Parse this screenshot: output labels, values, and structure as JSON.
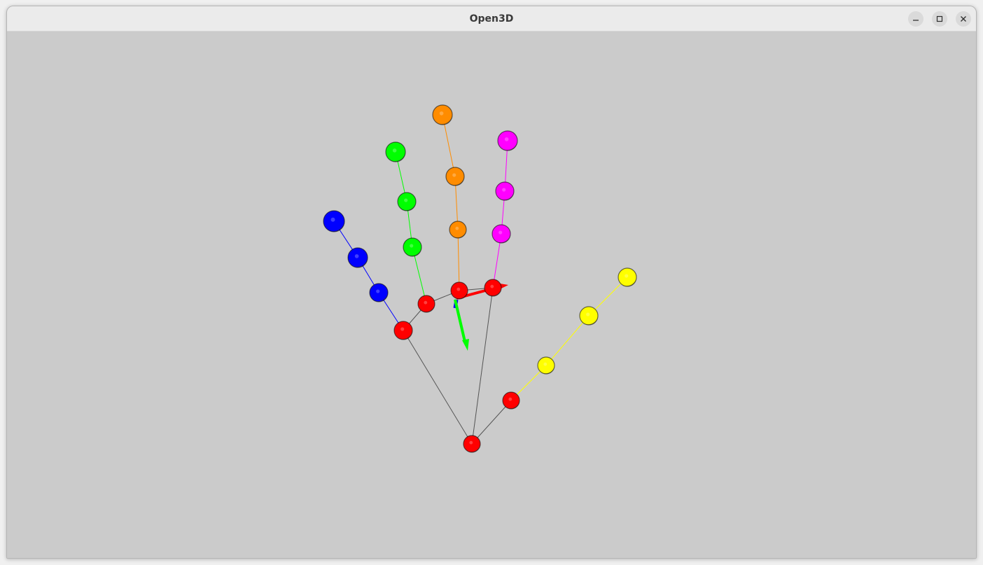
{
  "window": {
    "title": "Open3D",
    "controls": {
      "minimize": "minimize-icon",
      "maximize": "maximize-icon",
      "close": "close-icon"
    }
  },
  "scene": {
    "background_color": "#cbcbcb",
    "finger_colors": {
      "thumb": "#ffff00",
      "index": "#ff00ff",
      "middle": "#ff8c00",
      "ring": "#00ff00",
      "pinky": "#0000ff",
      "palm": "#ff0000",
      "palm_lines": "#555555"
    },
    "axes_colors": {
      "x": "#ff0000",
      "y": "#00ff00",
      "z": "#0000ff"
    },
    "joint_count": 21
  }
}
